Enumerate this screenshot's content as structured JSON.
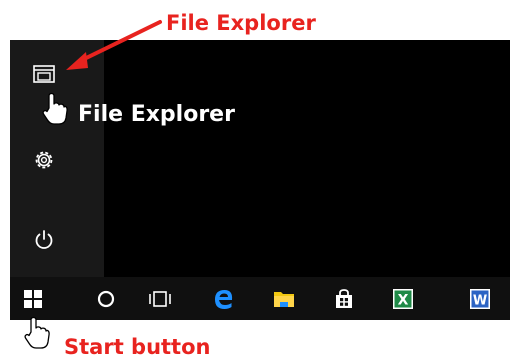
{
  "annotations": {
    "file_explorer_callout": "File Explorer",
    "start_button_callout": "Start button",
    "color": "#e8231f"
  },
  "start_menu": {
    "rail_items": [
      {
        "icon": "folder-icon",
        "label": "File Explorer"
      },
      {
        "icon": "gear-icon",
        "label": ""
      },
      {
        "icon": "power-icon",
        "label": ""
      }
    ],
    "tooltip": "File Explorer"
  },
  "taskbar": {
    "items": [
      {
        "icon": "windows-start-icon"
      },
      {
        "icon": "cortana-search-icon"
      },
      {
        "icon": "task-view-icon"
      },
      {
        "icon": "edge-browser-icon"
      },
      {
        "icon": "file-explorer-icon"
      },
      {
        "icon": "store-icon"
      },
      {
        "icon": "excel-icon",
        "letter": "X"
      },
      {
        "icon": "word-icon",
        "letter": "W"
      }
    ]
  }
}
